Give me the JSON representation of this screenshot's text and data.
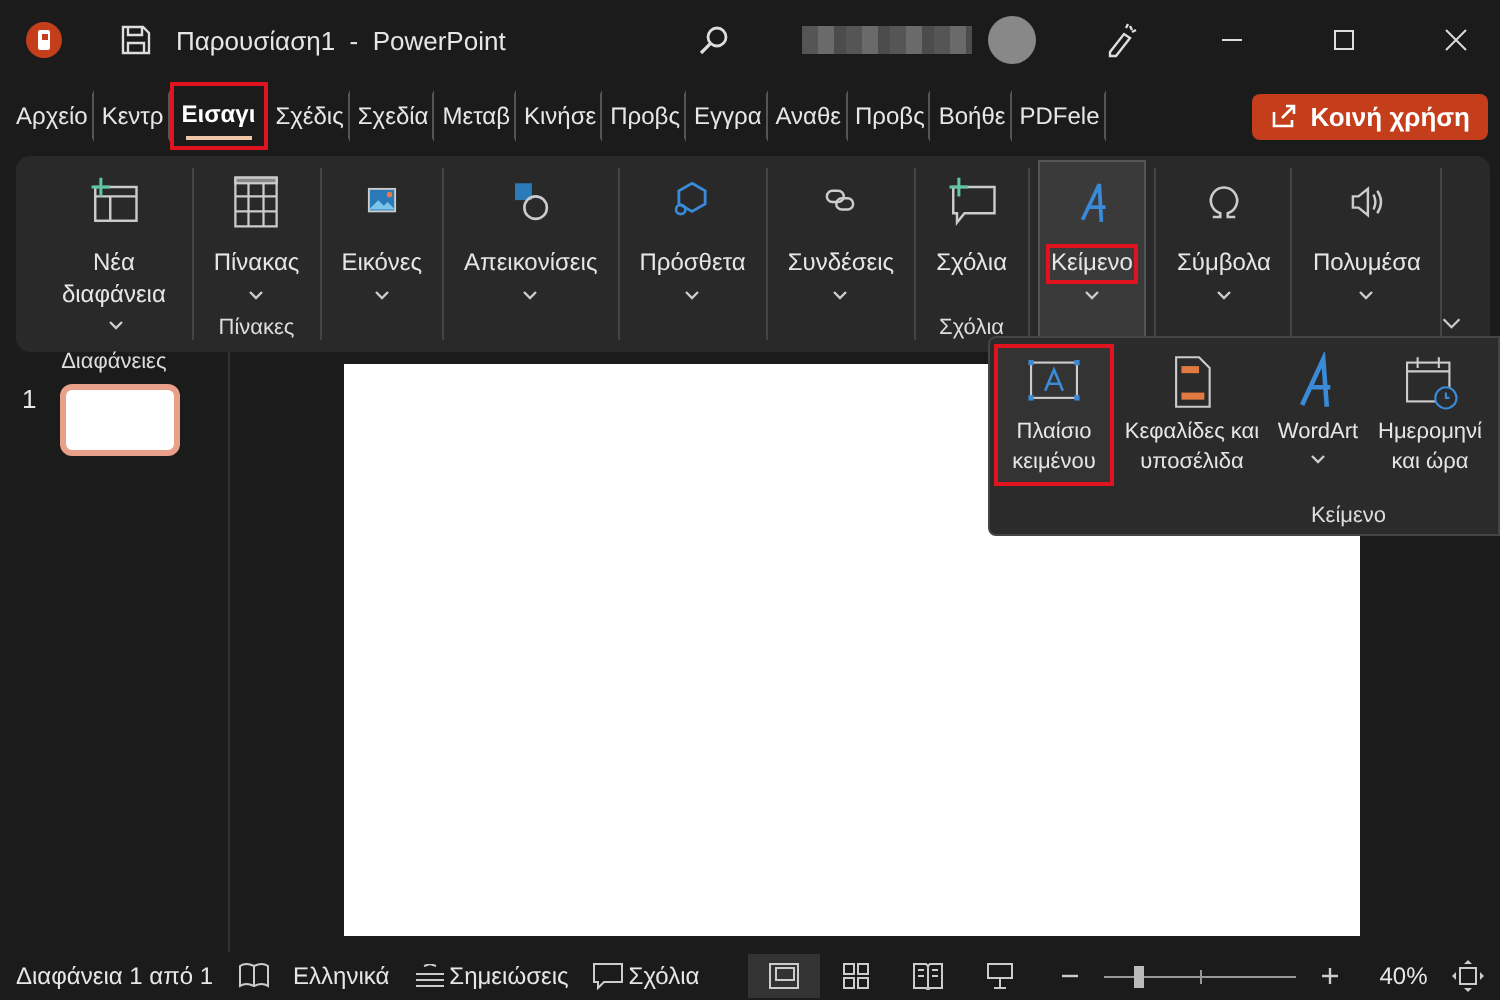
{
  "window": {
    "title": "Παρουσίαση1  -  PowerPoint"
  },
  "tabs": [
    {
      "label": "Αρχείο",
      "selected": false,
      "highlighted": false
    },
    {
      "label": "Κεντρ",
      "selected": false,
      "highlighted": false
    },
    {
      "label": "Εισαγι",
      "selected": true,
      "highlighted": true
    },
    {
      "label": "Σχέδις",
      "selected": false,
      "highlighted": false
    },
    {
      "label": "Σχεδία",
      "selected": false,
      "highlighted": false
    },
    {
      "label": "Μεταβ",
      "selected": false,
      "highlighted": false
    },
    {
      "label": "Κινήσε",
      "selected": false,
      "highlighted": false
    },
    {
      "label": "Προβς",
      "selected": false,
      "highlighted": false
    },
    {
      "label": "Εγγρα",
      "selected": false,
      "highlighted": false
    },
    {
      "label": "Αναθε",
      "selected": false,
      "highlighted": false
    },
    {
      "label": "Προβς",
      "selected": false,
      "highlighted": false
    },
    {
      "label": "Βοήθε",
      "selected": false,
      "highlighted": false
    },
    {
      "label": "PDFele",
      "selected": false,
      "highlighted": false
    }
  ],
  "share_button": {
    "label": "Κοινή χρήση"
  },
  "ribbon": {
    "groups": [
      {
        "label": "Διαφάνειες",
        "buttons": [
          {
            "label": "Νέα διαφάνεια",
            "dropdown": true,
            "highlighted": false,
            "expanded": false
          }
        ]
      },
      {
        "label": "Πίνακες",
        "buttons": [
          {
            "label": "Πίνακας",
            "dropdown": true,
            "highlighted": false,
            "expanded": false
          }
        ]
      },
      {
        "buttons": [
          {
            "label": "Εικόνες",
            "dropdown": true,
            "highlighted": false,
            "expanded": false
          }
        ]
      },
      {
        "buttons": [
          {
            "label": "Απεικονίσεις",
            "dropdown": true,
            "highlighted": false,
            "expanded": false
          }
        ]
      },
      {
        "buttons": [
          {
            "label": "Πρόσθετα",
            "dropdown": true,
            "highlighted": false,
            "expanded": false
          }
        ]
      },
      {
        "buttons": [
          {
            "label": "Συνδέσεις",
            "dropdown": true,
            "highlighted": false,
            "expanded": false
          }
        ]
      },
      {
        "label": "Σχόλια",
        "buttons": [
          {
            "label": "Σχόλια",
            "dropdown": false,
            "highlighted": false,
            "expanded": false
          }
        ]
      },
      {
        "buttons": [
          {
            "label": "Κείμενο",
            "dropdown": true,
            "highlighted": true,
            "expanded": true
          }
        ]
      },
      {
        "buttons": [
          {
            "label": "Σύμβολα",
            "dropdown": true,
            "highlighted": false,
            "expanded": false
          }
        ]
      },
      {
        "buttons": [
          {
            "label": "Πολυμέσα",
            "dropdown": true,
            "highlighted": false,
            "expanded": false
          }
        ]
      }
    ]
  },
  "text_menu": {
    "label": "Κείμενο",
    "items": [
      {
        "label": "Πλαίσιο κειμένου",
        "dropdown": false,
        "highlighted": true
      },
      {
        "label": "Κεφαλίδες και υποσέλιδα",
        "dropdown": false,
        "highlighted": false
      },
      {
        "label": "WordArt",
        "dropdown": true,
        "highlighted": false
      },
      {
        "label": "Ημερομηνί και ώρα",
        "dropdown": false,
        "highlighted": false
      }
    ]
  },
  "slides": [
    {
      "number": "1",
      "selected": true
    }
  ],
  "status_bar": {
    "slide_info": "Διαφάνεια 1 από 1",
    "language": "Ελληνικά",
    "notes": "Σημειώσεις",
    "comments": "Σχόλια",
    "views": [
      {
        "selected": true
      },
      {
        "selected": false
      },
      {
        "selected": false
      },
      {
        "selected": false
      }
    ],
    "zoom": {
      "level": 0.18,
      "reading": "40%"
    }
  }
}
